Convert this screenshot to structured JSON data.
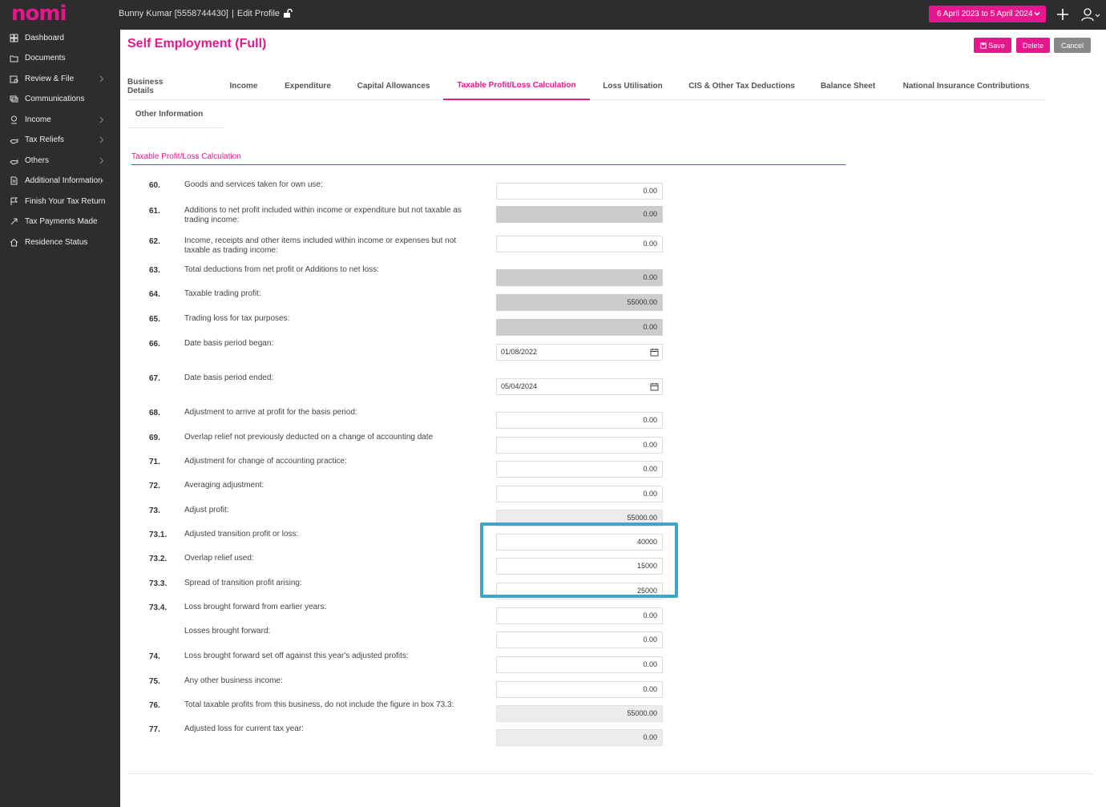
{
  "app": {
    "logo": "nomi"
  },
  "topbar": {
    "user": "Bunny Kumar [5558744430]",
    "separator": "|",
    "edit_profile": "Edit Profile",
    "period": "6 April 2023 to 5 April 2024"
  },
  "sidebar": {
    "items": [
      {
        "label": "Dashboard",
        "icon": "grid-icon",
        "submenu": false
      },
      {
        "label": "Documents",
        "icon": "folder-icon",
        "submenu": false
      },
      {
        "label": "Review & File",
        "icon": "review-icon",
        "submenu": true
      },
      {
        "label": "Communications",
        "icon": "chat-icon",
        "submenu": false
      },
      {
        "label": "Income",
        "icon": "money-icon",
        "submenu": true
      },
      {
        "label": "Tax Reliefs",
        "icon": "hand-icon",
        "submenu": true
      },
      {
        "label": "Others",
        "icon": "hand-icon",
        "submenu": true
      },
      {
        "label": "Additional Information",
        "icon": "document-icon",
        "submenu": true
      },
      {
        "label": "Finish Your Tax Return",
        "icon": "flag-icon",
        "submenu": false
      },
      {
        "label": "Tax Payments Made",
        "icon": "payment-icon",
        "submenu": false
      },
      {
        "label": "Residence Status",
        "icon": "home-icon",
        "submenu": false
      }
    ]
  },
  "page": {
    "title": "Self Employment (Full)",
    "buttons": {
      "save": "Save",
      "delete": "Delete",
      "cancel": "Cancel"
    },
    "tabs": [
      "Business Details",
      "Income",
      "Expenditure",
      "Capital Allowances",
      "Taxable Profit/Loss Calculation",
      "Loss Utilisation",
      "CIS & Other Tax Deductions",
      "Balance Sheet",
      "National Insurance Contributions",
      "Other Information"
    ],
    "active_tab": "Taxable Profit/Loss Calculation",
    "section_title": "Taxable Profit/Loss Calculation"
  },
  "rows": [
    {
      "num": "60.",
      "label": "Goods and services taken for own use:",
      "value": "0.00",
      "kind": "input"
    },
    {
      "num": "61.",
      "label": "Additions to net profit included within income or expenditure but not taxable as trading income:",
      "value": "0.00",
      "kind": "readonly"
    },
    {
      "num": "62.",
      "label": "Income, receipts and other items included within income or expenses but not taxable as trading income:",
      "value": "0.00",
      "kind": "input"
    },
    {
      "num": "63.",
      "label": "Total deductions from net profit or Additions to net loss:",
      "value": "0.00",
      "kind": "readonly"
    },
    {
      "num": "64.",
      "label": "Taxable trading profit:",
      "value": "55000.00",
      "kind": "readonly"
    },
    {
      "num": "65.",
      "label": "Trading loss for tax purposes:",
      "value": "0.00",
      "kind": "readonly"
    },
    {
      "num": "66.",
      "label": "Date basis period began:",
      "value": "01/08/2022",
      "kind": "date"
    },
    {
      "num": "67.",
      "label": "Date basis period ended:",
      "value": "05/04/2024",
      "kind": "date"
    },
    {
      "num": "68.",
      "label": "Adjustment to arrive at profit for the basis period:",
      "value": "0.00",
      "kind": "input"
    },
    {
      "num": "69.",
      "label": "Overlap relief not previously deducted on a change of accounting date",
      "value": "0.00",
      "kind": "input"
    },
    {
      "num": "71.",
      "label": "Adjustment for change of accounting practice:",
      "value": "0.00",
      "kind": "input"
    },
    {
      "num": "72.",
      "label": "Averaging adjustment:",
      "value": "0.00",
      "kind": "input"
    },
    {
      "num": "73.",
      "label": "Adjust profit:",
      "value": "55000.00",
      "kind": "readonly2"
    },
    {
      "num": "73.1.",
      "label": "Adjusted transition profit or loss:",
      "value": "40000",
      "kind": "input"
    },
    {
      "num": "73.2.",
      "label": "Overlap relief used:",
      "value": "15000",
      "kind": "input"
    },
    {
      "num": "73.3.",
      "label": "Spread of transition profit arising:",
      "value": "25000",
      "kind": "input"
    },
    {
      "num": "73.4.",
      "label": "Loss brought forward from earlier years:",
      "value": "0.00",
      "kind": "input"
    },
    {
      "num": "",
      "label": "Losses brought forward:",
      "value": "0.00",
      "kind": "input"
    },
    {
      "num": "74.",
      "label": "Loss brought forward set off against this year's adjusted profits:",
      "value": "0.00",
      "kind": "input"
    },
    {
      "num": "75.",
      "label": "Any other business income:",
      "value": "0.00",
      "kind": "input"
    },
    {
      "num": "76.",
      "label": "Total taxable profits from this business, do not include the figure in box 73.3:",
      "value": "55000.00",
      "kind": "readonly2"
    },
    {
      "num": "77.",
      "label": "Adjusted loss for current tax year:",
      "value": "0.00",
      "kind": "readonly2"
    }
  ]
}
